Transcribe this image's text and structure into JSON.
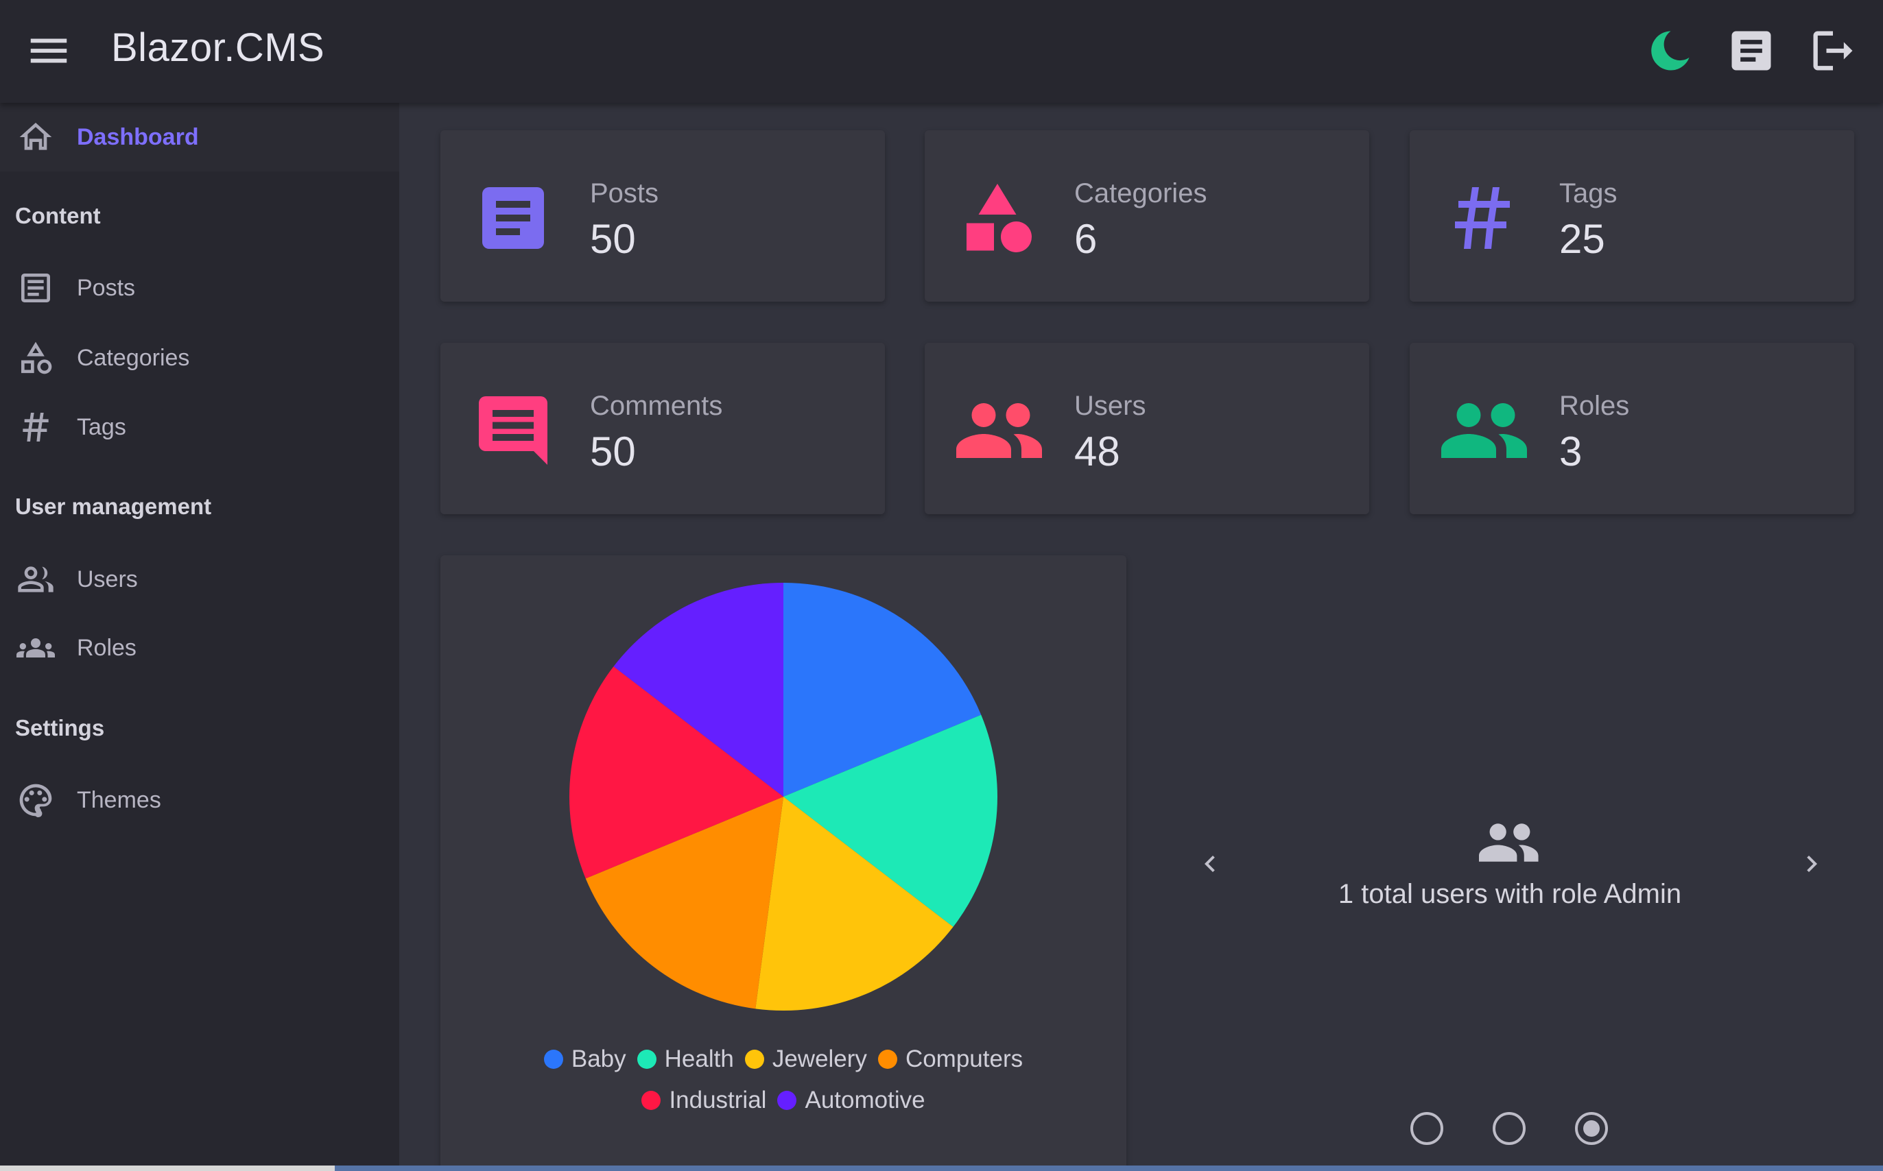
{
  "app": {
    "title": "Blazor.CMS"
  },
  "appbar": {
    "menu_icon": "menu-icon",
    "actions": [
      "dark-mode-icon",
      "docs-icon",
      "logout-icon"
    ],
    "theme_toggle_color": "#1ec185"
  },
  "sidebar": {
    "dashboard": {
      "label": "Dashboard",
      "icon": "home-icon",
      "active": true
    },
    "groups": [
      {
        "label": "Content",
        "items": [
          {
            "label": "Posts",
            "icon": "article-icon"
          },
          {
            "label": "Categories",
            "icon": "shapes-icon"
          },
          {
            "label": "Tags",
            "icon": "hashtag-icon"
          }
        ]
      },
      {
        "label": "User management",
        "items": [
          {
            "label": "Users",
            "icon": "people-icon"
          },
          {
            "label": "Roles",
            "icon": "groups-icon"
          }
        ]
      },
      {
        "label": "Settings",
        "items": [
          {
            "label": "Themes",
            "icon": "palette-icon"
          }
        ]
      }
    ]
  },
  "stats": [
    {
      "label": "Posts",
      "value": "50",
      "icon": "article-icon",
      "color": "#7b6cf0"
    },
    {
      "label": "Categories",
      "value": "6",
      "icon": "shapes-icon",
      "color": "#ff3e80"
    },
    {
      "label": "Tags",
      "value": "25",
      "icon": "hashtag-icon",
      "color": "#7b6cf0"
    },
    {
      "label": "Comments",
      "value": "50",
      "icon": "comment-icon",
      "color": "#ff3e80"
    },
    {
      "label": "Users",
      "value": "48",
      "icon": "people-icon",
      "color": "#ff4d6a"
    },
    {
      "label": "Roles",
      "value": "3",
      "icon": "people-icon",
      "color": "#10b77f"
    }
  ],
  "chart_data": {
    "type": "pie",
    "categories": [
      "Baby",
      "Health",
      "Jewelery",
      "Computers",
      "Industrial",
      "Automotive"
    ],
    "values": [
      9,
      8,
      8,
      8,
      8,
      7
    ],
    "colors": [
      "#2b76fb",
      "#1de9b6",
      "#ffc40a",
      "#ff8d00",
      "#ff1744",
      "#651fff"
    ],
    "legend": "bottom"
  },
  "carousel": {
    "text": "1 total users with role Admin",
    "icon": "groups-icon",
    "prev_icon": "chevron-left-icon",
    "next_icon": "chevron-right-icon",
    "slides": 3,
    "active_index": 2
  }
}
